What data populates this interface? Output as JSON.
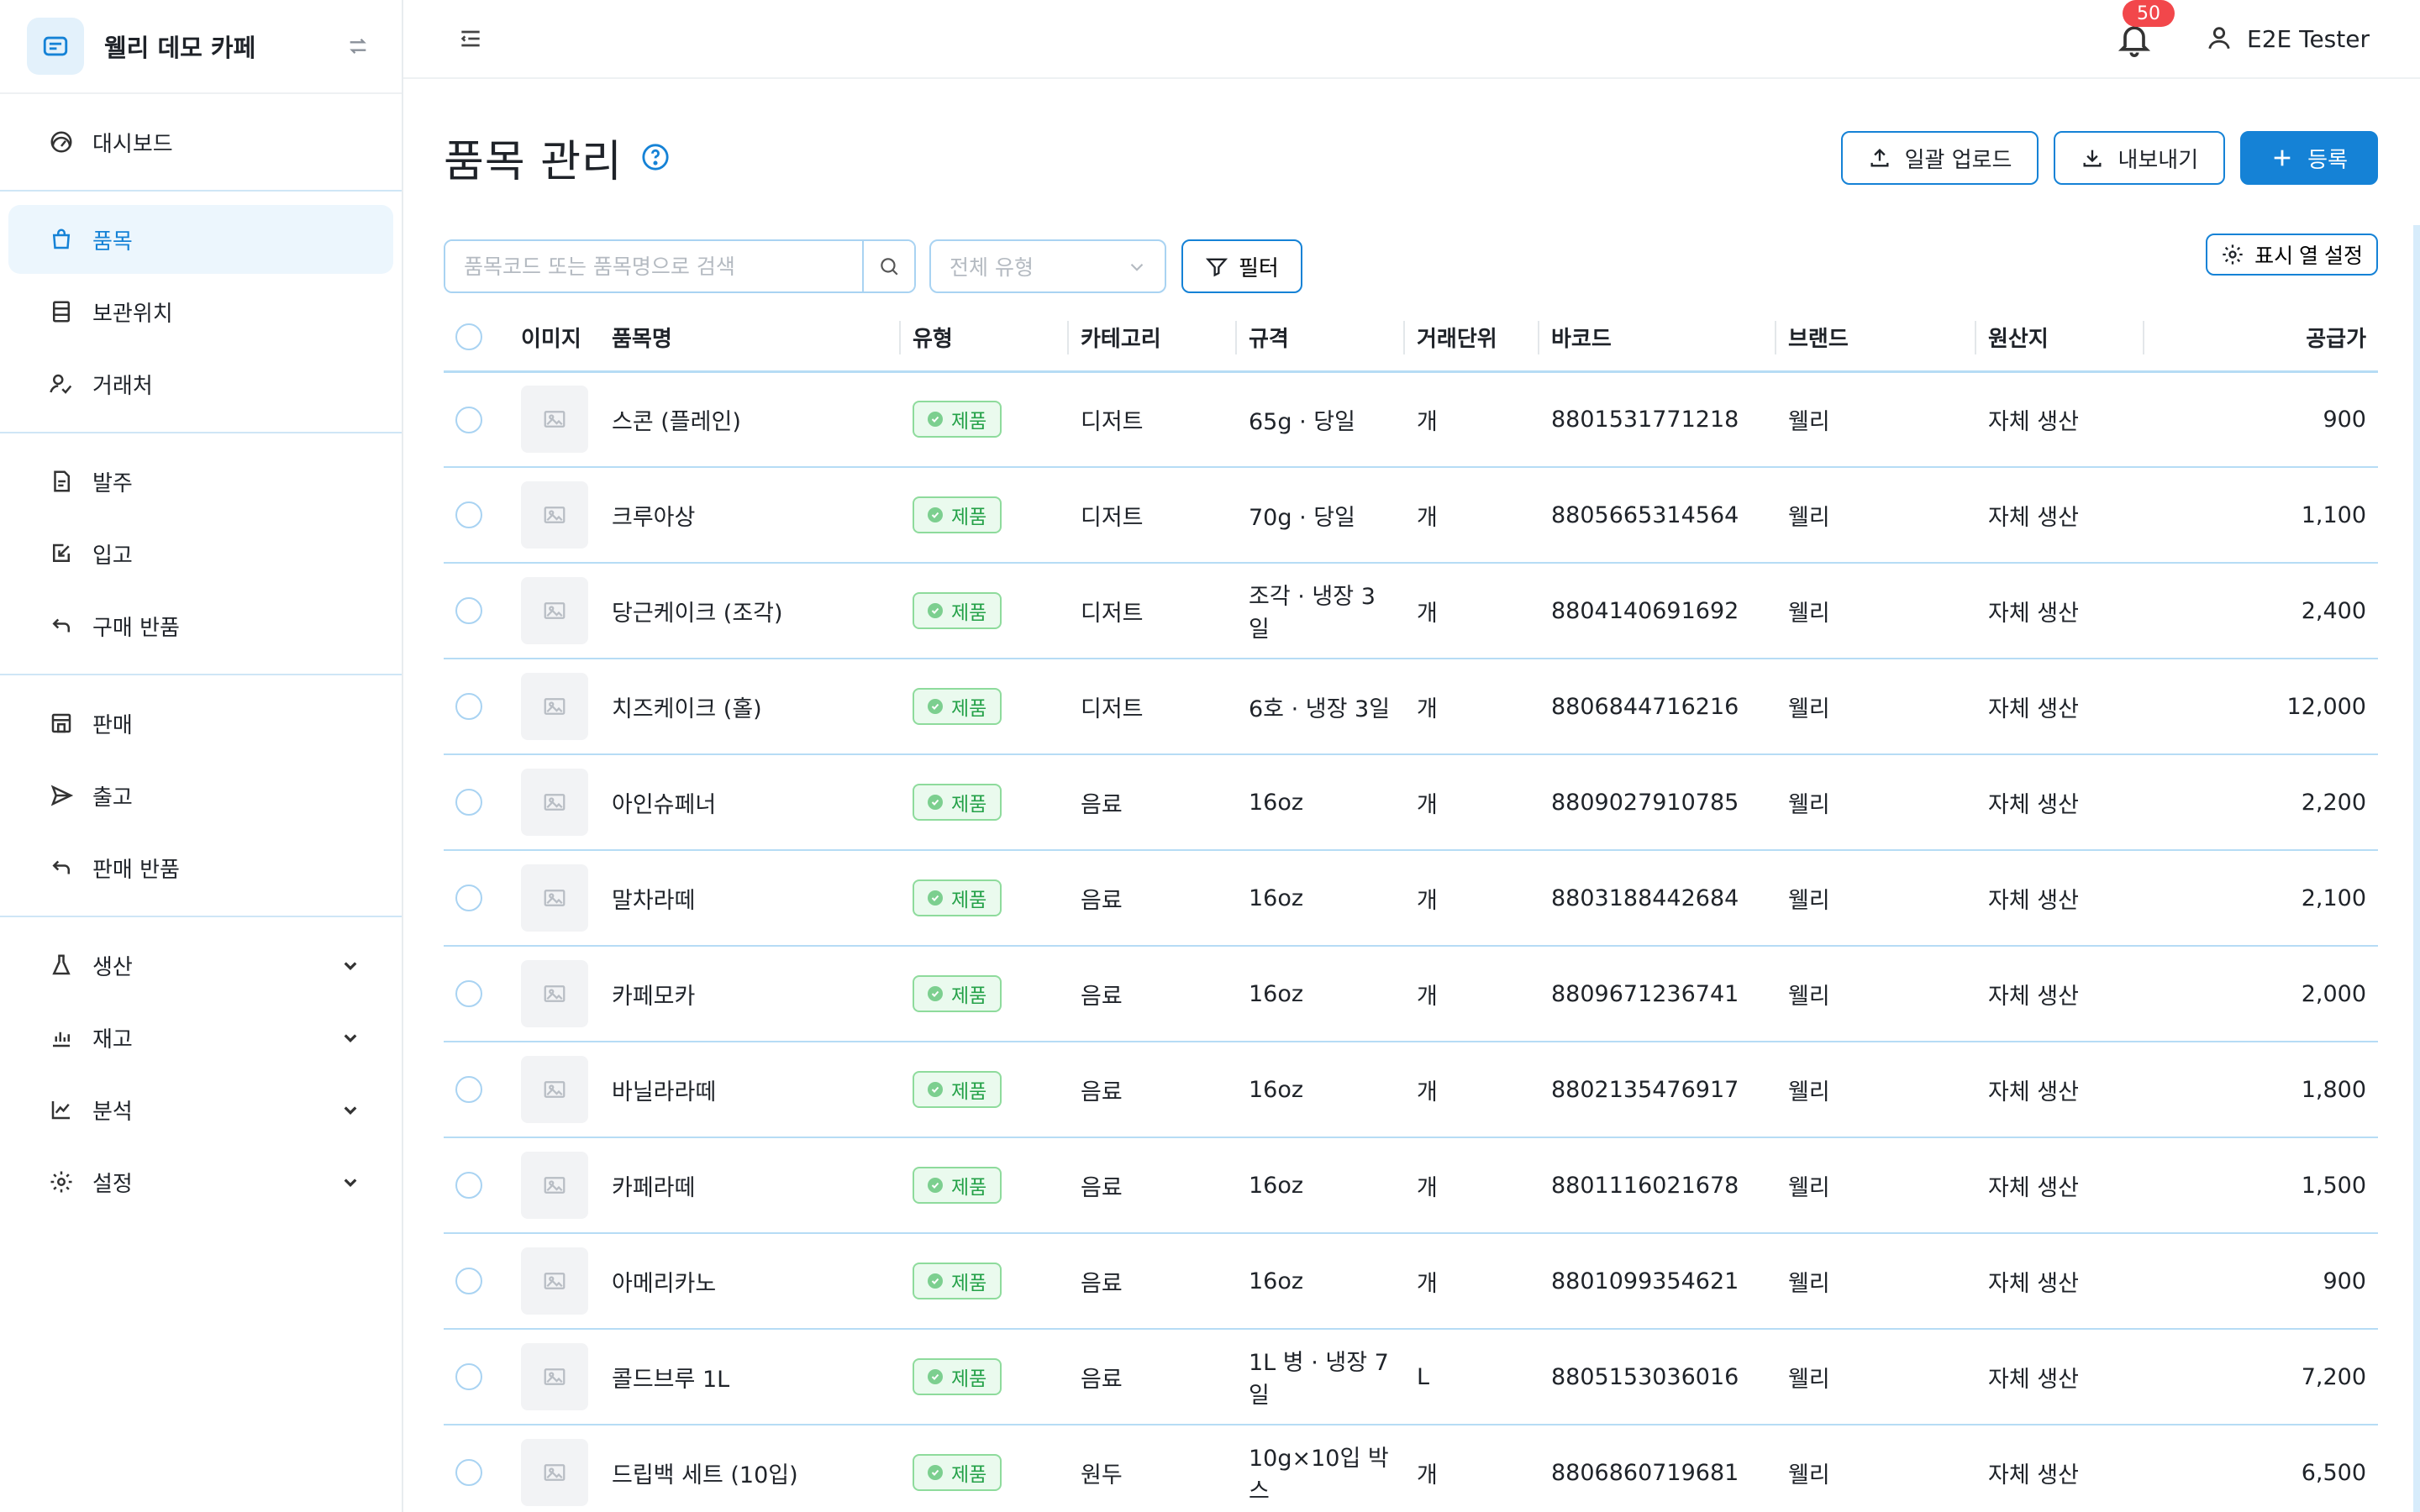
{
  "app": {
    "brand_name": "웰리 데모 카페",
    "user_name": "E2E Tester",
    "notification_count": "50",
    "accent_color": "#1582d6"
  },
  "sidebar": {
    "groups": [
      [
        {
          "label": "대시보드",
          "icon": "dashboard-icon"
        }
      ],
      [
        {
          "label": "품목",
          "icon": "shopping-bag-icon",
          "active": true
        },
        {
          "label": "보관위치",
          "icon": "storage-icon"
        },
        {
          "label": "거래처",
          "icon": "partners-icon"
        }
      ],
      [
        {
          "label": "발주",
          "icon": "document-icon"
        },
        {
          "label": "입고",
          "icon": "receive-icon"
        },
        {
          "label": "구매 반품",
          "icon": "return-icon"
        }
      ],
      [
        {
          "label": "판매",
          "icon": "store-icon"
        },
        {
          "label": "출고",
          "icon": "send-icon"
        },
        {
          "label": "판매 반품",
          "icon": "return-icon"
        }
      ],
      [
        {
          "label": "생산",
          "icon": "flask-icon",
          "expandable": true
        },
        {
          "label": "재고",
          "icon": "bar-chart-icon",
          "expandable": true
        },
        {
          "label": "분석",
          "icon": "line-chart-icon",
          "expandable": true
        },
        {
          "label": "설정",
          "icon": "gear-icon",
          "expandable": true
        }
      ]
    ]
  },
  "page": {
    "title": "품목 관리",
    "bulk_upload_label": "일괄 업로드",
    "export_label": "내보내기",
    "register_label": "등록",
    "search_placeholder": "품목코드 또는 품목명으로 검색",
    "type_select_value": "전체 유형",
    "filter_label": "필터",
    "column_settings_label": "표시 열 설정"
  },
  "table": {
    "columns": [
      "이미지",
      "품목명",
      "유형",
      "카테고리",
      "규격",
      "거래단위",
      "바코드",
      "브랜드",
      "원산지",
      "공급가"
    ],
    "rows": [
      {
        "name": "스콘 (플레인)",
        "type": "제품",
        "category": "디저트",
        "spec": "65g · 당일",
        "unit": "개",
        "barcode": "8801531771218",
        "brand": "웰리",
        "origin": "자체 생산",
        "price": "900"
      },
      {
        "name": "크루아상",
        "type": "제품",
        "category": "디저트",
        "spec": "70g · 당일",
        "unit": "개",
        "barcode": "8805665314564",
        "brand": "웰리",
        "origin": "자체 생산",
        "price": "1,100"
      },
      {
        "name": "당근케이크 (조각)",
        "type": "제품",
        "category": "디저트",
        "spec": "조각 · 냉장 3일",
        "unit": "개",
        "barcode": "8804140691692",
        "brand": "웰리",
        "origin": "자체 생산",
        "price": "2,400"
      },
      {
        "name": "치즈케이크 (홀)",
        "type": "제품",
        "category": "디저트",
        "spec": "6호 · 냉장 3일",
        "unit": "개",
        "barcode": "8806844716216",
        "brand": "웰리",
        "origin": "자체 생산",
        "price": "12,000"
      },
      {
        "name": "아인슈페너",
        "type": "제품",
        "category": "음료",
        "spec": "16oz",
        "unit": "개",
        "barcode": "8809027910785",
        "brand": "웰리",
        "origin": "자체 생산",
        "price": "2,200"
      },
      {
        "name": "말차라떼",
        "type": "제품",
        "category": "음료",
        "spec": "16oz",
        "unit": "개",
        "barcode": "8803188442684",
        "brand": "웰리",
        "origin": "자체 생산",
        "price": "2,100"
      },
      {
        "name": "카페모카",
        "type": "제품",
        "category": "음료",
        "spec": "16oz",
        "unit": "개",
        "barcode": "8809671236741",
        "brand": "웰리",
        "origin": "자체 생산",
        "price": "2,000"
      },
      {
        "name": "바닐라라떼",
        "type": "제품",
        "category": "음료",
        "spec": "16oz",
        "unit": "개",
        "barcode": "8802135476917",
        "brand": "웰리",
        "origin": "자체 생산",
        "price": "1,800"
      },
      {
        "name": "카페라떼",
        "type": "제품",
        "category": "음료",
        "spec": "16oz",
        "unit": "개",
        "barcode": "8801116021678",
        "brand": "웰리",
        "origin": "자체 생산",
        "price": "1,500"
      },
      {
        "name": "아메리카노",
        "type": "제품",
        "category": "음료",
        "spec": "16oz",
        "unit": "개",
        "barcode": "8801099354621",
        "brand": "웰리",
        "origin": "자체 생산",
        "price": "900"
      },
      {
        "name": "콜드브루 1L",
        "type": "제품",
        "category": "음료",
        "spec": "1L 병 · 냉장 7일",
        "unit": "L",
        "barcode": "8805153036016",
        "brand": "웰리",
        "origin": "자체 생산",
        "price": "7,200"
      },
      {
        "name": "드립백 세트 (10입)",
        "type": "제품",
        "category": "원두",
        "spec": "10g×10입 박스",
        "unit": "개",
        "barcode": "8806860719681",
        "brand": "웰리",
        "origin": "자체 생산",
        "price": "6,500"
      }
    ]
  }
}
